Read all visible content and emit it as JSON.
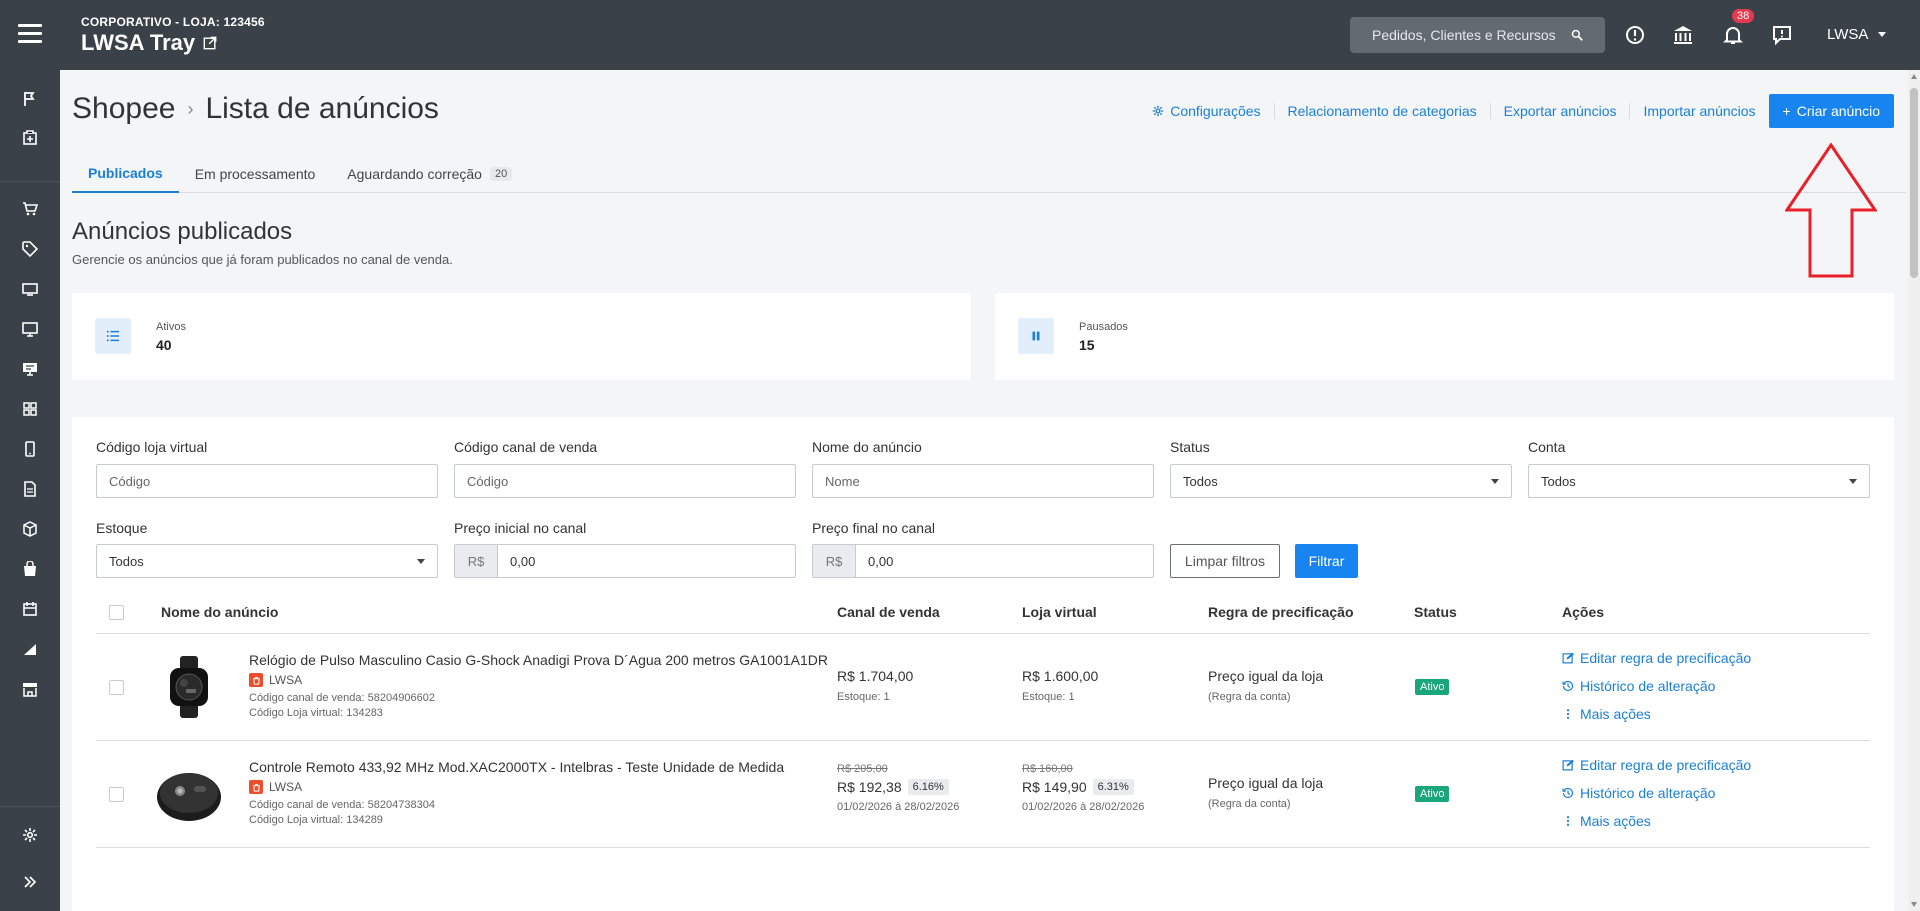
{
  "topbar": {
    "store_sub": "CORPORATIVO - LOJA: 123456",
    "store_name": "LWSA Tray",
    "search_placeholder": "Pedidos, Clientes e Recursos",
    "notifications_count": "38",
    "user": "LWSA"
  },
  "breadcrumb": {
    "parent": "Shopee",
    "current": "Lista de anúncios"
  },
  "top_actions": {
    "settings": "Configurações",
    "category_mapping": "Relacionamento de categorias",
    "export": "Exportar anúncios",
    "import": "Importar anúncios",
    "create": "Criar anúncio"
  },
  "tabs": {
    "published": "Publicados",
    "processing": "Em processamento",
    "awaiting": "Aguardando correção",
    "awaiting_count": "20"
  },
  "section": {
    "title": "Anúncios publicados",
    "subtitle": "Gerencie os anúncios que já foram publicados no canal de venda."
  },
  "stats": {
    "active_label": "Ativos",
    "active_value": "40",
    "paused_label": "Pausados",
    "paused_value": "15"
  },
  "filters": {
    "store_code_label": "Código loja virtual",
    "store_code_placeholder": "Código",
    "channel_code_label": "Código canal de venda",
    "channel_code_placeholder": "Código",
    "name_label": "Nome do anúncio",
    "name_placeholder": "Nome",
    "status_label": "Status",
    "status_value": "Todos",
    "account_label": "Conta",
    "account_value": "Todos",
    "stock_label": "Estoque",
    "stock_value": "Todos",
    "price_start_label": "Preço inicial no canal",
    "price_start_prefix": "R$",
    "price_start_value": "0,00",
    "price_end_label": "Preço final no canal",
    "price_end_prefix": "R$",
    "price_end_value": "0,00",
    "clear_button": "Limpar filtros",
    "filter_button": "Filtrar"
  },
  "table": {
    "headers": {
      "name": "Nome do anúncio",
      "channel": "Canal de venda",
      "store": "Loja virtual",
      "rule": "Regra de precificação",
      "status": "Status",
      "actions": "Ações"
    },
    "rows": [
      {
        "title": "Relógio de Pulso Masculino Casio G-Shock Anadigi Prova D´Agua 200 metros GA1001A1DR",
        "store": "LWSA",
        "channel_code": "Código canal de venda: 58204906602",
        "store_code": "Código Loja virtual: 134283",
        "channel_price": "R$ 1.704,00",
        "channel_stock": "Estoque: 1",
        "store_price": "R$ 1.600,00",
        "store_stock": "Estoque: 1",
        "rule": "Preço igual da loja",
        "rule_sub": "(Regra da conta)",
        "status": "Ativo",
        "action_edit": "Editar regra de precificação",
        "action_history": "Histórico de alteração",
        "action_more": "Mais ações"
      },
      {
        "title": "Controle Remoto 433,92 MHz Mod.XAC2000TX - Intelbras - Teste Unidade de Medida",
        "store": "LWSA",
        "channel_code": "Código canal de venda: 58204738304",
        "store_code": "Código Loja virtual: 134289",
        "channel_old_price": "R$ 205,00",
        "channel_price": "R$ 192,38",
        "channel_discount": "6.16%",
        "channel_period": "01/02/2026 à 28/02/2026",
        "store_old_price": "R$ 160,00",
        "store_price": "R$ 149,90",
        "store_discount": "6.31%",
        "store_period": "01/02/2026 à 28/02/2026",
        "rule": "Preço igual da loja",
        "rule_sub": "(Regra da conta)",
        "status": "Ativo",
        "action_edit": "Editar regra de precificação",
        "action_history": "Histórico de alteração",
        "action_more": "Mais ações"
      }
    ]
  },
  "colors": {
    "sidebar": "#3a4148",
    "accent": "#1784ef",
    "status_active": "#18a67a",
    "annotation": "#e8202a"
  }
}
